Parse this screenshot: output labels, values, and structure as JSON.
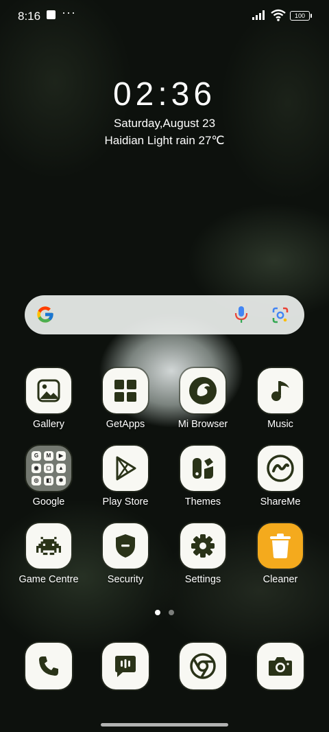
{
  "status_bar": {
    "time": "8:16",
    "battery": "100",
    "more": "···"
  },
  "widget": {
    "clock": "02:36",
    "date": "Saturday,August 23",
    "weather": "Haidian Light rain 27℃"
  },
  "search_bar": {
    "logo_icon": "google-g-icon",
    "mic_icon": "microphone-icon",
    "lens_icon": "google-lens-icon"
  },
  "apps": [
    {
      "label": "Gallery",
      "icon": "image-icon"
    },
    {
      "label": "GetApps",
      "icon": "grid-icon"
    },
    {
      "label": "Mi Browser",
      "icon": "browser-icon"
    },
    {
      "label": "Music",
      "icon": "music-note-icon"
    },
    {
      "label": "Google",
      "icon": "folder-icon"
    },
    {
      "label": "Play Store",
      "icon": "play-triangle-icon"
    },
    {
      "label": "Themes",
      "icon": "themes-icon"
    },
    {
      "label": "ShareMe",
      "icon": "shareme-icon"
    },
    {
      "label": "Game Centre",
      "icon": "space-invader-icon"
    },
    {
      "label": "Security",
      "icon": "shield-icon"
    },
    {
      "label": "Settings",
      "icon": "gear-icon"
    },
    {
      "label": "Cleaner",
      "icon": "trash-can-icon"
    }
  ],
  "folder_minis": [
    "G",
    "M",
    "▶",
    "◉",
    "▢",
    "▲",
    "◎",
    "◧",
    "✱",
    "▤"
  ],
  "page_indicator": {
    "pages": 2,
    "current": 1
  },
  "dock": [
    {
      "name": "phone",
      "icon": "phone-icon"
    },
    {
      "name": "messages",
      "icon": "message-icon"
    },
    {
      "name": "chrome",
      "icon": "chrome-icon"
    },
    {
      "name": "camera",
      "icon": "camera-icon"
    }
  ],
  "colors": {
    "icon_bg": "#f8f8f3",
    "icon_glyph": "#2a3318",
    "cleaner_bg": "#f4aa1d"
  }
}
